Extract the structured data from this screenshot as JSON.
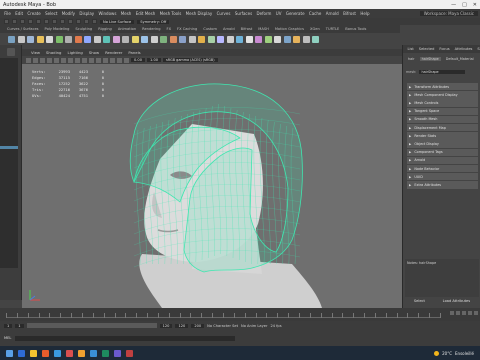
{
  "window": {
    "title": "Autodesk Maya - Bob",
    "controls": [
      "—",
      "□",
      "✕"
    ]
  },
  "menubar": {
    "items": [
      "File",
      "Edit",
      "Create",
      "Select",
      "Modify",
      "Display",
      "Windows",
      "Mesh",
      "Edit Mesh",
      "Mesh Tools",
      "Mesh Display",
      "Curves",
      "Surfaces",
      "Deform",
      "UV",
      "Generate",
      "Cache",
      "Arnold",
      "Bifrost",
      "Help"
    ],
    "workspace": "Workspace: Maya Classic"
  },
  "statusline": {
    "selection_field": "No Live Surface",
    "symmetry_field": "Symmetry: Off"
  },
  "shelf": {
    "tabs": [
      "Curves / Surfaces",
      "Poly Modeling",
      "Sculpting",
      "Rigging",
      "Animation",
      "Rendering",
      "FX",
      "FX Caching",
      "Custom",
      "Arnold",
      "Bifrost",
      "MASH",
      "Motion Graphics",
      "XGen",
      "TURTLE",
      "Bonus Tools"
    ],
    "icon_colors": [
      "#7aa2c2",
      "#c7c7c7",
      "#9fb7d6",
      "#e8c05a",
      "#d9d9d9",
      "#7dbf6a",
      "#b0b0b0",
      "#e07a4d",
      "#8fa8ff",
      "#c9c9c9",
      "#5ec2b7",
      "#d6a4d8",
      "#b5b5b5",
      "#e4d36a",
      "#9cc3e8",
      "#cfcfcf",
      "#7fb37f",
      "#d98c5f",
      "#8aa0c8",
      "#c4c4c4",
      "#e2b04a",
      "#a7d0a7",
      "#b8b8ff",
      "#d0d0d0",
      "#6fb3d9",
      "#e3e3e3",
      "#c98ad1",
      "#9fd07f",
      "#d8d8d8",
      "#7da4c9",
      "#e6b35c",
      "#bdbdbd",
      "#8fd0c0"
    ]
  },
  "viewport": {
    "panel_menu": [
      "View",
      "Shading",
      "Lighting",
      "Show",
      "Renderer",
      "Panels"
    ],
    "exposure": "0.00",
    "gamma": "1.00",
    "color_space": "sRGB gamma (ACES) (sRGB)",
    "hud": {
      "rows": [
        {
          "label": "Verts:",
          "c1": "23993",
          "c2": "4423",
          "c3": "0"
        },
        {
          "label": "Edges:",
          "c1": "37115",
          "c2": "7166",
          "c3": "0"
        },
        {
          "label": "Faces:",
          "c1": "17252",
          "c2": "3622",
          "c3": "0"
        },
        {
          "label": "Tris:",
          "c1": "22716",
          "c2": "3676",
          "c3": "0"
        },
        {
          "label": "UVs:",
          "c1": "40424",
          "c2": "4751",
          "c3": "0"
        }
      ]
    },
    "wire_color": "#3fe7b0",
    "model_color": "#d9d9d9"
  },
  "right_panel": {
    "tabs": [
      "List",
      "Selected",
      "Focus",
      "Attributes",
      "Show",
      "Help"
    ],
    "subtabs": [
      "hair",
      "hairShape",
      "Default_Material",
      "MASH"
    ],
    "active_subtab": "hairShape",
    "field_label": "mesh:",
    "field_value": "hairShape",
    "sections": [
      "Transform Attributes",
      "Mesh Component Display",
      "Mesh Controls",
      "Tangent Space",
      "Smooth Mesh",
      "Displacement Map",
      "Render Stats",
      "Object Display",
      "Component Tags",
      "Arnold",
      "Node Behavior",
      "UUID",
      "Extra Attributes"
    ],
    "notes_label": "Notes: hairShape",
    "buttons": [
      "Select",
      "Load Attributes",
      "Copy Tab"
    ]
  },
  "time": {
    "start": "1",
    "end": "120",
    "range_start": "1",
    "range_end": "120",
    "range_mid": "120",
    "playback_end": "200",
    "character_set": "No Character Set",
    "anim_layer": "No Anim Layer",
    "fps": "24 fps"
  },
  "mel": {
    "label": "MEL"
  },
  "taskbar": {
    "app_colors": [
      "#2e6bd6",
      "#f4c430",
      "#e85d2c",
      "#3b9ae1",
      "#d94f4f",
      "#f0a030",
      "#3a8fd6",
      "#1e8a5f",
      "#6b5acd",
      "#c04040"
    ],
    "temperature": "20°C",
    "weather": "Ensoleillé"
  }
}
